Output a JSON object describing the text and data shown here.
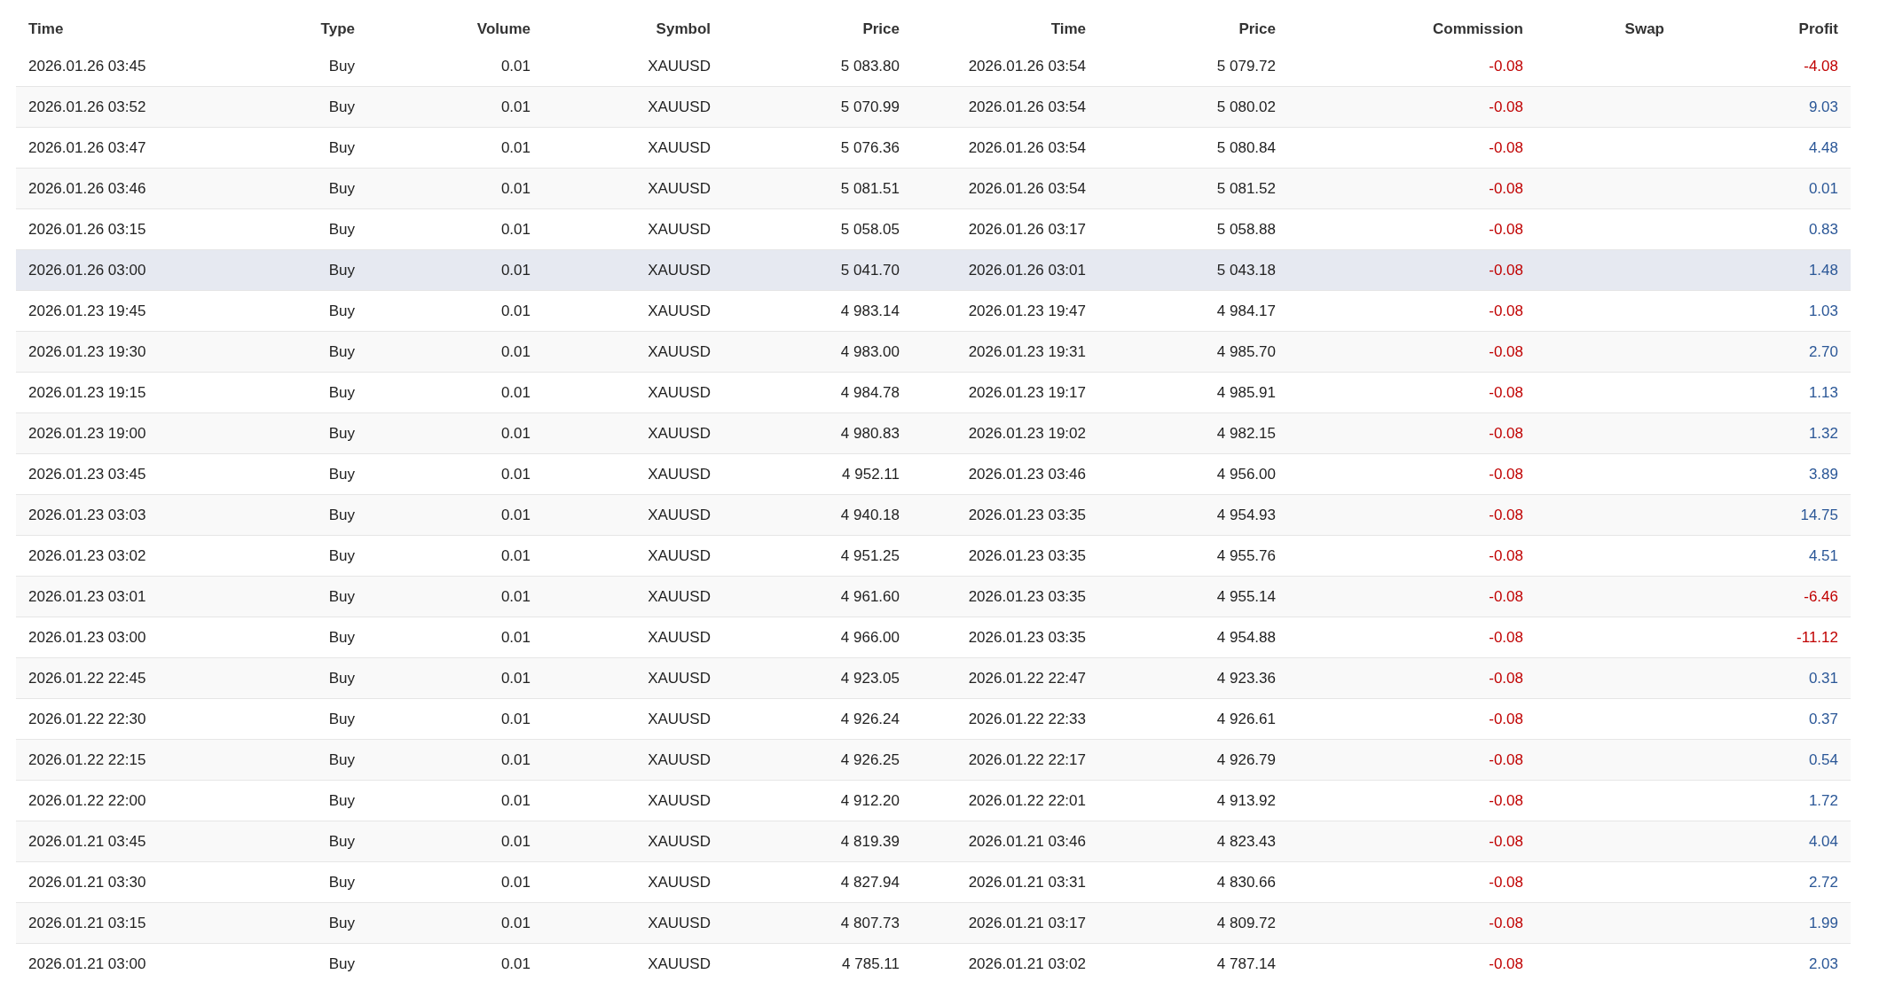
{
  "table": {
    "columns": [
      "Time",
      "Type",
      "Volume",
      "Symbol",
      "Price",
      "Time",
      "Price",
      "Commission",
      "Swap",
      "Profit"
    ],
    "rows": [
      {
        "open_time": "2026.01.26 03:45",
        "type": "Buy",
        "volume": "0.01",
        "symbol": "XAUUSD",
        "open_price": "5 083.80",
        "close_time": "2026.01.26 03:54",
        "close_price": "5 079.72",
        "commission": "-0.08",
        "profit": {
          "value": "-4.08",
          "color": "#c00000"
        },
        "selected": false
      },
      {
        "open_time": "2026.01.26 03:52",
        "type": "Buy",
        "volume": "0.01",
        "symbol": "XAUUSD",
        "open_price": "5 070.99",
        "close_time": "2026.01.26 03:54",
        "close_price": "5 080.02",
        "commission": "-0.08",
        "profit": {
          "value": "9.03",
          "color": "#2b5797"
        },
        "selected": false
      },
      {
        "open_time": "2026.01.26 03:47",
        "type": "Buy",
        "volume": "0.01",
        "symbol": "XAUUSD",
        "open_price": "5 076.36",
        "close_time": "2026.01.26 03:54",
        "close_price": "5 080.84",
        "commission": "-0.08",
        "profit": {
          "value": "4.48",
          "color": "#2b5797"
        },
        "selected": false
      },
      {
        "open_time": "2026.01.26 03:46",
        "type": "Buy",
        "volume": "0.01",
        "symbol": "XAUUSD",
        "open_price": "5 081.51",
        "close_time": "2026.01.26 03:54",
        "close_price": "5 081.52",
        "commission": "-0.08",
        "profit": {
          "value": "0.01",
          "color": "#2b5797"
        },
        "selected": false
      },
      {
        "open_time": "2026.01.26 03:15",
        "type": "Buy",
        "volume": "0.01",
        "symbol": "XAUUSD",
        "open_price": "5 058.05",
        "close_time": "2026.01.26 03:17",
        "close_price": "5 058.88",
        "commission": "-0.08",
        "profit": {
          "value": "0.83",
          "color": "#2b5797"
        },
        "selected": false
      },
      {
        "open_time": "2026.01.26 03:00",
        "type": "Buy",
        "volume": "0.01",
        "symbol": "XAUUSD",
        "open_price": "5 041.70",
        "close_time": "2026.01.26 03:01",
        "close_price": "5 043.18",
        "commission": "-0.08",
        "profit": {
          "value": "1.48",
          "color": "#2b5797"
        },
        "selected": true
      },
      {
        "open_time": "2026.01.23 19:45",
        "type": "Buy",
        "volume": "0.01",
        "symbol": "XAUUSD",
        "open_price": "4 983.14",
        "close_time": "2026.01.23 19:47",
        "close_price": "4 984.17",
        "commission": "-0.08",
        "profit": {
          "value": "1.03",
          "color": "#2b5797"
        },
        "selected": false
      },
      {
        "open_time": "2026.01.23 19:30",
        "type": "Buy",
        "volume": "0.01",
        "symbol": "XAUUSD",
        "open_price": "4 983.00",
        "close_time": "2026.01.23 19:31",
        "close_price": "4 985.70",
        "commission": "-0.08",
        "profit": {
          "value": "2.70",
          "color": "#2b5797"
        },
        "selected": false
      },
      {
        "open_time": "2026.01.23 19:15",
        "type": "Buy",
        "volume": "0.01",
        "symbol": "XAUUSD",
        "open_price": "4 984.78",
        "close_time": "2026.01.23 19:17",
        "close_price": "4 985.91",
        "commission": "-0.08",
        "profit": {
          "value": "1.13",
          "color": "#2b5797"
        },
        "selected": false
      },
      {
        "open_time": "2026.01.23 19:00",
        "type": "Buy",
        "volume": "0.01",
        "symbol": "XAUUSD",
        "open_price": "4 980.83",
        "close_time": "2026.01.23 19:02",
        "close_price": "4 982.15",
        "commission": "-0.08",
        "profit": {
          "value": "1.32",
          "color": "#2b5797"
        },
        "selected": false
      },
      {
        "open_time": "2026.01.23 03:45",
        "type": "Buy",
        "volume": "0.01",
        "symbol": "XAUUSD",
        "open_price": "4 952.11",
        "close_time": "2026.01.23 03:46",
        "close_price": "4 956.00",
        "commission": "-0.08",
        "profit": {
          "value": "3.89",
          "color": "#2b5797"
        },
        "selected": false
      },
      {
        "open_time": "2026.01.23 03:03",
        "type": "Buy",
        "volume": "0.01",
        "symbol": "XAUUSD",
        "open_price": "4 940.18",
        "close_time": "2026.01.23 03:35",
        "close_price": "4 954.93",
        "commission": "-0.08",
        "profit": {
          "value": "14.75",
          "color": "#2b5797"
        },
        "selected": false
      },
      {
        "open_time": "2026.01.23 03:02",
        "type": "Buy",
        "volume": "0.01",
        "symbol": "XAUUSD",
        "open_price": "4 951.25",
        "close_time": "2026.01.23 03:35",
        "close_price": "4 955.76",
        "commission": "-0.08",
        "profit": {
          "value": "4.51",
          "color": "#2b5797"
        },
        "selected": false
      },
      {
        "open_time": "2026.01.23 03:01",
        "type": "Buy",
        "volume": "0.01",
        "symbol": "XAUUSD",
        "open_price": "4 961.60",
        "close_time": "2026.01.23 03:35",
        "close_price": "4 955.14",
        "commission": "-0.08",
        "profit": {
          "value": "-6.46",
          "color": "#c00000"
        },
        "selected": false
      },
      {
        "open_time": "2026.01.23 03:00",
        "type": "Buy",
        "volume": "0.01",
        "symbol": "XAUUSD",
        "open_price": "4 966.00",
        "close_time": "2026.01.23 03:35",
        "close_price": "4 954.88",
        "commission": "-0.08",
        "profit": {
          "value": "-11.12",
          "color": "#c00000"
        },
        "selected": false
      },
      {
        "open_time": "2026.01.22 22:45",
        "type": "Buy",
        "volume": "0.01",
        "symbol": "XAUUSD",
        "open_price": "4 923.05",
        "close_time": "2026.01.22 22:47",
        "close_price": "4 923.36",
        "commission": "-0.08",
        "profit": {
          "value": "0.31",
          "color": "#2b5797"
        },
        "selected": false
      },
      {
        "open_time": "2026.01.22 22:30",
        "type": "Buy",
        "volume": "0.01",
        "symbol": "XAUUSD",
        "open_price": "4 926.24",
        "close_time": "2026.01.22 22:33",
        "close_price": "4 926.61",
        "commission": "-0.08",
        "profit": {
          "value": "0.37",
          "color": "#2b5797"
        },
        "selected": false
      },
      {
        "open_time": "2026.01.22 22:15",
        "type": "Buy",
        "volume": "0.01",
        "symbol": "XAUUSD",
        "open_price": "4 926.25",
        "close_time": "2026.01.22 22:17",
        "close_price": "4 926.79",
        "commission": "-0.08",
        "profit": {
          "value": "0.54",
          "color": "#2b5797"
        },
        "selected": false
      },
      {
        "open_time": "2026.01.22 22:00",
        "type": "Buy",
        "volume": "0.01",
        "symbol": "XAUUSD",
        "open_price": "4 912.20",
        "close_time": "2026.01.22 22:01",
        "close_price": "4 913.92",
        "commission": "-0.08",
        "profit": {
          "value": "1.72",
          "color": "#2b5797"
        },
        "selected": false
      },
      {
        "open_time": "2026.01.21 03:45",
        "type": "Buy",
        "volume": "0.01",
        "symbol": "XAUUSD",
        "open_price": "4 819.39",
        "close_time": "2026.01.21 03:46",
        "close_price": "4 823.43",
        "commission": "-0.08",
        "profit": {
          "value": "4.04",
          "color": "#2b5797"
        },
        "selected": false
      },
      {
        "open_time": "2026.01.21 03:30",
        "type": "Buy",
        "volume": "0.01",
        "symbol": "XAUUSD",
        "open_price": "4 827.94",
        "close_time": "2026.01.21 03:31",
        "close_price": "4 830.66",
        "commission": "-0.08",
        "profit": {
          "value": "2.72",
          "color": "#2b5797"
        },
        "selected": false
      },
      {
        "open_time": "2026.01.21 03:15",
        "type": "Buy",
        "volume": "0.01",
        "symbol": "XAUUSD",
        "open_price": "4 807.73",
        "close_time": "2026.01.21 03:17",
        "close_price": "4 809.72",
        "commission": "-0.08",
        "profit": {
          "value": "1.99",
          "color": "#2b5797"
        },
        "selected": false
      },
      {
        "open_time": "2026.01.21 03:00",
        "type": "Buy",
        "volume": "0.01",
        "symbol": "XAUUSD",
        "open_price": "4 785.11",
        "close_time": "2026.01.21 03:02",
        "close_price": "4 787.14",
        "commission": "-0.08",
        "profit": {
          "value": "2.03",
          "color": "#2b5797"
        },
        "selected": false
      }
    ]
  }
}
